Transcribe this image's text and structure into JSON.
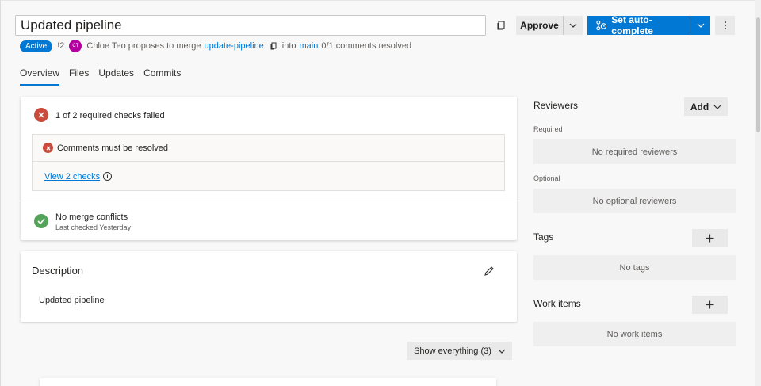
{
  "header": {
    "title": "Updated pipeline",
    "approve_label": "Approve",
    "autocomplete_label": "Set auto-complete"
  },
  "meta": {
    "status": "Active",
    "pr_id": "!2",
    "avatar_initials": "CT",
    "author_text": "Chloe Teo proposes to merge",
    "source_branch": "update-pipeline",
    "into_text": "into",
    "target_branch": "main",
    "comments_resolved": "0/1 comments resolved"
  },
  "tabs": [
    {
      "label": "Overview",
      "active": true
    },
    {
      "label": "Files"
    },
    {
      "label": "Updates"
    },
    {
      "label": "Commits"
    }
  ],
  "checks": {
    "summary": "1 of 2 required checks failed",
    "comments_status": "Comments must be resolved",
    "view_checks": "View 2 checks",
    "merge_status": "No merge conflicts",
    "merge_sub": "Last checked Yesterday"
  },
  "description": {
    "title": "Description",
    "text": "Updated pipeline"
  },
  "show_everything": "Show everything (3)",
  "sidebar": {
    "reviewers_title": "Reviewers",
    "add_label": "Add",
    "required_label": "Required",
    "required_empty": "No required reviewers",
    "optional_label": "Optional",
    "optional_empty": "No optional reviewers",
    "tags_title": "Tags",
    "tags_empty": "No tags",
    "work_items_title": "Work items",
    "work_items_empty": "No work items"
  },
  "colors": {
    "accent": "#0078d4",
    "fail": "#c84b3c",
    "success": "#56a45b",
    "avatar": "#b4009e"
  },
  "icons": [
    "copy-icon",
    "chevron-down-icon",
    "auto-complete-icon",
    "more-icon",
    "error-icon",
    "info-icon",
    "check-icon",
    "edit-icon",
    "plus-icon"
  ]
}
